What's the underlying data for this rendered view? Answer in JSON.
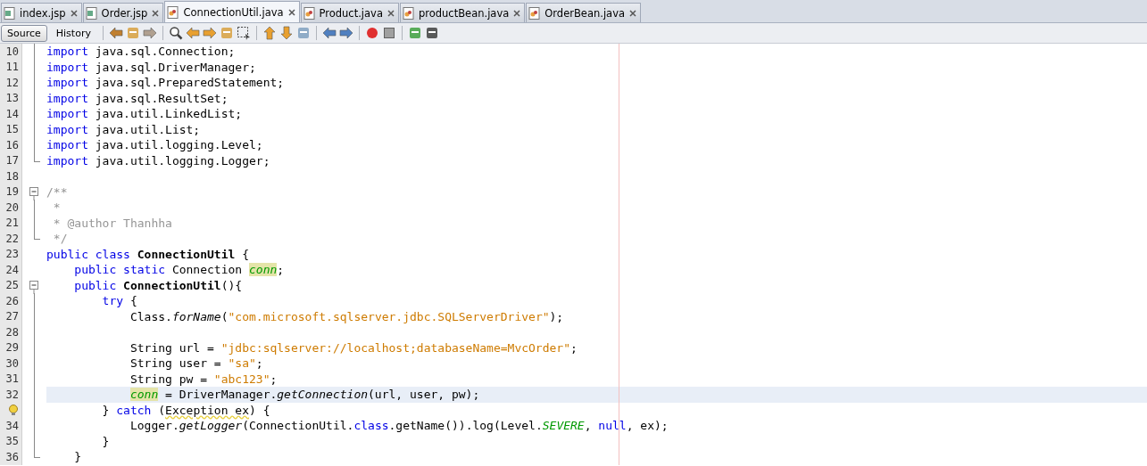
{
  "tabs": [
    {
      "label": "index.jsp",
      "kind": "jsp",
      "selected": false
    },
    {
      "label": "Order.jsp",
      "kind": "jsp",
      "selected": false
    },
    {
      "label": "ConnectionUtil.java",
      "kind": "java",
      "selected": true
    },
    {
      "label": "Product.java",
      "kind": "java",
      "selected": false
    },
    {
      "label": "productBean.java",
      "kind": "java",
      "selected": false
    },
    {
      "label": "OrderBean.java",
      "kind": "java",
      "selected": false
    }
  ],
  "views": [
    {
      "label": "Source",
      "selected": true
    },
    {
      "label": "History",
      "selected": false
    }
  ],
  "lines": [
    {
      "number": "10",
      "kind": "fold-body",
      "tokens": [
        {
          "kind": "kw",
          "text": "import"
        },
        {
          "kind": "plain",
          "text": " java.sql.Connection;"
        }
      ]
    },
    {
      "number": "11",
      "kind": "fold-body",
      "tokens": [
        {
          "kind": "kw",
          "text": "import"
        },
        {
          "kind": "plain",
          "text": " java.sql.DriverManager;"
        }
      ]
    },
    {
      "number": "12",
      "kind": "fold-body",
      "tokens": [
        {
          "kind": "kw",
          "text": "import"
        },
        {
          "kind": "plain",
          "text": " java.sql.PreparedStatement;"
        }
      ]
    },
    {
      "number": "13",
      "kind": "fold-body",
      "tokens": [
        {
          "kind": "kw",
          "text": "import"
        },
        {
          "kind": "plain",
          "text": " java.sql.ResultSet;"
        }
      ]
    },
    {
      "number": "14",
      "kind": "fold-body",
      "tokens": [
        {
          "kind": "kw",
          "text": "import"
        },
        {
          "kind": "plain",
          "text": " java.util.LinkedList;"
        }
      ]
    },
    {
      "number": "15",
      "kind": "fold-body",
      "tokens": [
        {
          "kind": "kw",
          "text": "import"
        },
        {
          "kind": "plain",
          "text": " java.util.List;"
        }
      ]
    },
    {
      "number": "16",
      "kind": "fold-body",
      "tokens": [
        {
          "kind": "kw",
          "text": "import"
        },
        {
          "kind": "plain",
          "text": " java.util.logging.Level;"
        }
      ]
    },
    {
      "number": "17",
      "kind": "fold-end",
      "tokens": [
        {
          "kind": "kw",
          "text": "import"
        },
        {
          "kind": "plain",
          "text": " java.util.logging.Logger;"
        }
      ]
    },
    {
      "number": "18",
      "kind": "plain"
    },
    {
      "number": "19",
      "kind": "fold-start",
      "tokens": [
        {
          "kind": "comment",
          "text": "/**"
        }
      ]
    },
    {
      "number": "20",
      "kind": "fold-body",
      "tokens": [
        {
          "kind": "comment",
          "text": " *"
        }
      ]
    },
    {
      "number": "21",
      "kind": "fold-body",
      "tokens": [
        {
          "kind": "comment",
          "text": " * @author Thanhha"
        }
      ]
    },
    {
      "number": "22",
      "kind": "fold-end",
      "tokens": [
        {
          "kind": "comment",
          "text": " */"
        }
      ]
    },
    {
      "number": "23",
      "kind": "plain",
      "tokens": [
        {
          "kind": "kw",
          "text": "public class "
        },
        {
          "kind": "bold",
          "text": "ConnectionUtil"
        },
        {
          "kind": "plain",
          "text": " {"
        }
      ]
    },
    {
      "number": "24",
      "kind": "plain",
      "tokens": [
        {
          "kind": "kw",
          "text": "    public static"
        },
        {
          "kind": "plain",
          "text": " Connection "
        },
        {
          "kind": "field",
          "text": "conn",
          "highlight": true
        },
        {
          "kind": "plain",
          "text": ";"
        }
      ]
    },
    {
      "number": "25",
      "kind": "fold-start",
      "tokens": [
        {
          "kind": "kw",
          "text": "    public "
        },
        {
          "kind": "bold",
          "text": "ConnectionUtil"
        },
        {
          "kind": "plain",
          "text": "(){"
        }
      ]
    },
    {
      "number": "26",
      "kind": "fold-body",
      "tokens": [
        {
          "kind": "kw",
          "text": "        try"
        },
        {
          "kind": "plain",
          "text": " {"
        }
      ]
    },
    {
      "number": "27",
      "kind": "fold-body",
      "tokens": [
        {
          "kind": "plain",
          "text": "            Class."
        },
        {
          "kind": "italic",
          "text": "forName"
        },
        {
          "kind": "plain",
          "text": "("
        },
        {
          "kind": "str",
          "text": "\"com.microsoft.sqlserver.jdbc.SQLServerDriver\""
        },
        {
          "kind": "plain",
          "text": ");"
        }
      ]
    },
    {
      "number": "28",
      "kind": "fold-body"
    },
    {
      "number": "29",
      "kind": "fold-body",
      "tokens": [
        {
          "kind": "plain",
          "text": "            String url = "
        },
        {
          "kind": "str",
          "text": "\"jdbc:sqlserver://localhost;databaseName=MvcOrder\""
        },
        {
          "kind": "plain",
          "text": ";"
        }
      ]
    },
    {
      "number": "30",
      "kind": "fold-body",
      "tokens": [
        {
          "kind": "plain",
          "text": "            String user = "
        },
        {
          "kind": "str",
          "text": "\"sa\""
        },
        {
          "kind": "plain",
          "text": ";"
        }
      ]
    },
    {
      "number": "31",
      "kind": "fold-body",
      "tokens": [
        {
          "kind": "plain",
          "text": "            String pw = "
        },
        {
          "kind": "str",
          "text": "\"abc123\""
        },
        {
          "kind": "plain",
          "text": ";"
        }
      ]
    },
    {
      "number": "32",
      "kind": "fold-body",
      "current": true,
      "tokens": [
        {
          "kind": "field",
          "text": "            conn",
          "highlight": true
        },
        {
          "kind": "plain",
          "text": " = DriverManager."
        },
        {
          "kind": "italic",
          "text": "getConnection"
        },
        {
          "kind": "plain",
          "text": "(url, user, pw);"
        }
      ]
    },
    {
      "kind": "fold-body",
      "warning": true,
      "tokens": [
        {
          "kind": "plain",
          "text": "        } "
        },
        {
          "kind": "kw",
          "text": "catch"
        },
        {
          "kind": "plain",
          "text": " ("
        },
        {
          "kind": "warn",
          "text": "Exception ex"
        },
        {
          "kind": "plain",
          "text": ") {"
        }
      ]
    },
    {
      "number": "34",
      "kind": "fold-body",
      "tokens": [
        {
          "kind": "plain",
          "text": "            Logger."
        },
        {
          "kind": "italic",
          "text": "getLogger"
        },
        {
          "kind": "plain",
          "text": "(ConnectionUtil."
        },
        {
          "kind": "kw",
          "text": "class"
        },
        {
          "kind": "plain",
          "text": ".getName()).log(Level."
        },
        {
          "kind": "field",
          "text": "SEVERE"
        },
        {
          "kind": "plain",
          "text": ", "
        },
        {
          "kind": "kw",
          "text": "null"
        },
        {
          "kind": "plain",
          "text": ", ex);"
        }
      ]
    },
    {
      "number": "35",
      "kind": "fold-body",
      "tokens": [
        {
          "kind": "plain",
          "text": "        }"
        }
      ]
    },
    {
      "number": "36",
      "kind": "fold-end",
      "tokens": [
        {
          "kind": "plain",
          "text": "    }"
        }
      ]
    }
  ]
}
